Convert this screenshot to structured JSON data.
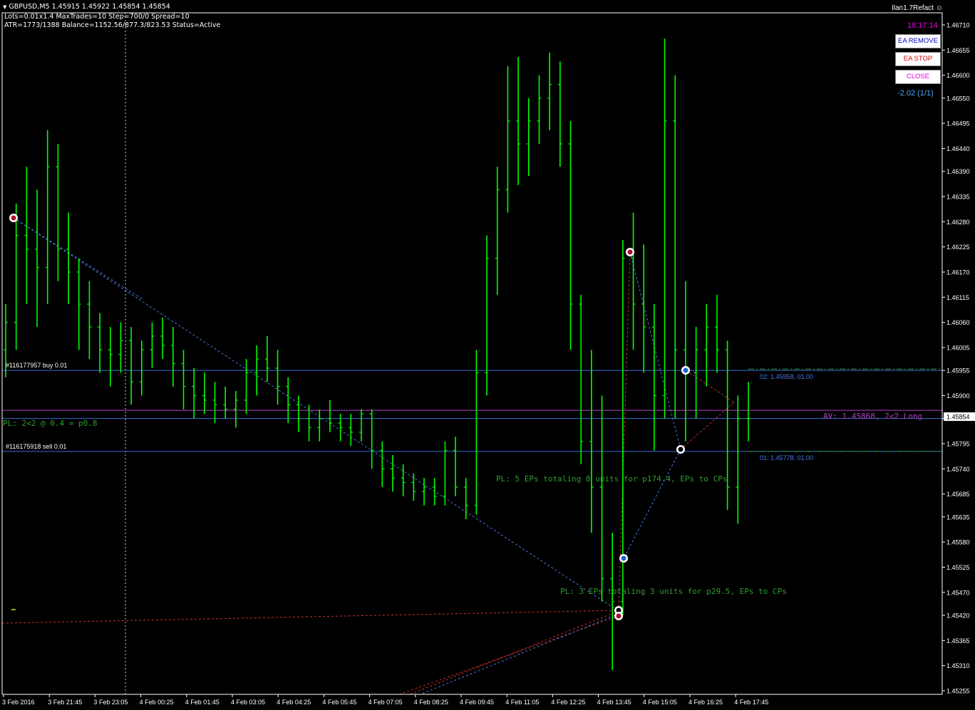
{
  "header": {
    "symbol_line": "GBPUSD,M5  1.45915 1.45922 1.45854 1.45854",
    "params_line": "Lots=0.01x1.4 MaxTrades=10 Step=700/0 Spread=10",
    "status_line": "ATR=1773/1388 Balance=1152.56/877.3/823.53 Status=Active"
  },
  "ea_panel": {
    "name": "Ilan1.7Refact",
    "time": "18:17:14",
    "buttons": [
      {
        "label": "EA REMOVE",
        "color": "#0000cc"
      },
      {
        "label": "EA STOP",
        "color": "#e00000"
      },
      {
        "label": "CLOSE",
        "color": "#e000e0"
      }
    ],
    "pl": "-2.02 (1/1)"
  },
  "chart_data": {
    "type": "bar",
    "instrument": "GBPUSD",
    "timeframe": "M5",
    "y_ticks": [
      "1.46710",
      "1.46655",
      "1.46600",
      "1.46550",
      "1.46495",
      "1.46440",
      "1.46390",
      "1.46335",
      "1.46280",
      "1.46225",
      "1.46170",
      "1.46115",
      "1.46060",
      "1.46005",
      "1.45955",
      "1.45900",
      "1.45850",
      "1.45795",
      "1.45740",
      "1.45685",
      "1.45635",
      "1.45580",
      "1.45525",
      "1.45470",
      "1.45420",
      "1.45365",
      "1.45310",
      "1.45255"
    ],
    "ylim": [
      1.45255,
      1.4671
    ],
    "current_price": "1.45854",
    "x_ticks": [
      "3 Feb 2016",
      "3 Feb 21:45",
      "3 Feb 23:05",
      "4 Feb 00:25",
      "4 Feb 01:45",
      "4 Feb 03:05",
      "4 Feb 04:25",
      "4 Feb 05:45",
      "4 Feb 07:05",
      "4 Feb 08:25",
      "4 Feb 09:45",
      "4 Feb 11:05",
      "4 Feb 12:25",
      "4 Feb 13:45",
      "4 Feb 15:05",
      "4 Feb 16:25",
      "4 Feb 17:45"
    ],
    "bar_color": "#00ff00",
    "bars": [
      [
        1.46,
        1.461,
        1.4594,
        1.4606
      ],
      [
        1.4606,
        1.4632,
        1.46,
        1.4625
      ],
      [
        1.4625,
        1.464,
        1.461,
        1.4622
      ],
      [
        1.4622,
        1.4635,
        1.4605,
        1.4618
      ],
      [
        1.4618,
        1.4648,
        1.461,
        1.464
      ],
      [
        1.464,
        1.4645,
        1.4615,
        1.4622
      ],
      [
        1.4622,
        1.463,
        1.461,
        1.4617
      ],
      [
        1.4617,
        1.462,
        1.46,
        1.461
      ],
      [
        1.461,
        1.4615,
        1.4598,
        1.4605
      ],
      [
        1.4605,
        1.4608,
        1.4595,
        1.46
      ],
      [
        1.46,
        1.4605,
        1.4592,
        1.4599
      ],
      [
        1.4599,
        1.4606,
        1.4595,
        1.4602
      ],
      [
        1.4602,
        1.4605,
        1.4588,
        1.4593
      ],
      [
        1.4593,
        1.4602,
        1.459,
        1.46
      ],
      [
        1.46,
        1.4606,
        1.4596,
        1.4603
      ],
      [
        1.4603,
        1.4607,
        1.4598,
        1.4601
      ],
      [
        1.4601,
        1.4605,
        1.4592,
        1.4597
      ],
      [
        1.4597,
        1.46,
        1.4587,
        1.4592
      ],
      [
        1.4592,
        1.4596,
        1.4585,
        1.459
      ],
      [
        1.459,
        1.4595,
        1.4586,
        1.4589
      ],
      [
        1.4589,
        1.4593,
        1.4584,
        1.4588
      ],
      [
        1.4588,
        1.4592,
        1.4585,
        1.4587
      ],
      [
        1.4587,
        1.4591,
        1.4583,
        1.4589
      ],
      [
        1.4589,
        1.4598,
        1.4586,
        1.4595
      ],
      [
        1.4595,
        1.4601,
        1.459,
        1.4598
      ],
      [
        1.4598,
        1.4603,
        1.4593,
        1.4596
      ],
      [
        1.4596,
        1.46,
        1.4588,
        1.4592
      ],
      [
        1.4592,
        1.4594,
        1.4584,
        1.4588
      ],
      [
        1.4588,
        1.459,
        1.4582,
        1.4585
      ],
      [
        1.4585,
        1.4588,
        1.458,
        1.4583
      ],
      [
        1.4583,
        1.4587,
        1.458,
        1.4585
      ],
      [
        1.4585,
        1.4589,
        1.4582,
        1.4584
      ],
      [
        1.4584,
        1.4586,
        1.458,
        1.4583
      ],
      [
        1.4583,
        1.4586,
        1.4579,
        1.4582
      ],
      [
        1.4582,
        1.4587,
        1.458,
        1.4586
      ],
      [
        1.4586,
        1.4587,
        1.4574,
        1.4578
      ],
      [
        1.4578,
        1.458,
        1.457,
        1.4574
      ],
      [
        1.4574,
        1.4577,
        1.4569,
        1.4572
      ],
      [
        1.4572,
        1.4575,
        1.4568,
        1.4571
      ],
      [
        1.4571,
        1.4573,
        1.4567,
        1.4569
      ],
      [
        1.4569,
        1.4572,
        1.4566,
        1.457
      ],
      [
        1.457,
        1.4572,
        1.4566,
        1.4568
      ],
      [
        1.4568,
        1.458,
        1.4566,
        1.4578
      ],
      [
        1.4578,
        1.4581,
        1.4568,
        1.457
      ],
      [
        1.457,
        1.4572,
        1.4563,
        1.4566
      ],
      [
        1.4566,
        1.46,
        1.4564,
        1.4595
      ],
      [
        1.4595,
        1.4625,
        1.459,
        1.462
      ],
      [
        1.462,
        1.464,
        1.4612,
        1.4635
      ],
      [
        1.4635,
        1.4662,
        1.463,
        1.465
      ],
      [
        1.465,
        1.4664,
        1.4636,
        1.4645
      ],
      [
        1.4645,
        1.4655,
        1.4638,
        1.465
      ],
      [
        1.465,
        1.466,
        1.4645,
        1.4655
      ],
      [
        1.4655,
        1.4665,
        1.4648,
        1.4658
      ],
      [
        1.4658,
        1.4663,
        1.464,
        1.4645
      ],
      [
        1.4645,
        1.465,
        1.46,
        1.461
      ],
      [
        1.461,
        1.4612,
        1.4575,
        1.458
      ],
      [
        1.458,
        1.46,
        1.456,
        1.457
      ],
      [
        1.457,
        1.459,
        1.4545,
        1.455
      ],
      [
        1.455,
        1.456,
        1.453,
        1.4545
      ],
      [
        1.4545,
        1.4624,
        1.4542,
        1.462
      ],
      [
        1.462,
        1.463,
        1.46,
        1.461
      ],
      [
        1.461,
        1.4623,
        1.4595,
        1.4605
      ],
      [
        1.4605,
        1.461,
        1.4578,
        1.459
      ],
      [
        1.459,
        1.4668,
        1.4585,
        1.465
      ],
      [
        1.465,
        1.466,
        1.4585,
        1.46
      ],
      [
        1.46,
        1.4615,
        1.458,
        1.4595
      ],
      [
        1.4595,
        1.4605,
        1.4585,
        1.46
      ],
      [
        1.46,
        1.461,
        1.4592,
        1.4605
      ],
      [
        1.4605,
        1.4612,
        1.4595,
        1.46
      ],
      [
        1.46,
        1.4602,
        1.4565,
        1.457
      ],
      [
        1.457,
        1.459,
        1.4562,
        1.4585
      ],
      [
        1.4585,
        1.4593,
        1.458,
        1.4585
      ]
    ],
    "price_lines": [
      {
        "price": 1.45955,
        "color": "#3a6cd8",
        "label": "#116177957 buy 0.01",
        "right_label": "02: 1.45958,  01.00",
        "right_color": "#4a7ae0"
      },
      {
        "price": 1.4585,
        "color": "#3a6cd8",
        "label": "",
        "right_label": "",
        "right_color": ""
      },
      {
        "price": 1.45868,
        "color": "#b040c0",
        "label": "",
        "right_label": "AV: 1.45868, 2<2 Long",
        "right_color": "#b040c0"
      },
      {
        "price": 1.45778,
        "color": "#3a6cd8",
        "label": "#116175918 sell 0.01",
        "right_label": "01: 1.45778,  01.00",
        "right_color": "#4a7ae0"
      }
    ],
    "annotations": [
      {
        "text": "PL: 2<2 @ 0.4 = p0.8",
        "color": "#2e9e2e"
      },
      {
        "text": "PL: 5 EPs totaling 8 units for p174.4, EPs to CPs",
        "color": "#2e9e2e"
      },
      {
        "text": "PL: 3 EPs totaling 3 units for p29.5, EPs to CPs",
        "color": "#2e9e2e"
      }
    ],
    "trade_colors": {
      "buy": "#4a7ae0",
      "sell": "#d03030"
    },
    "grid": false
  }
}
